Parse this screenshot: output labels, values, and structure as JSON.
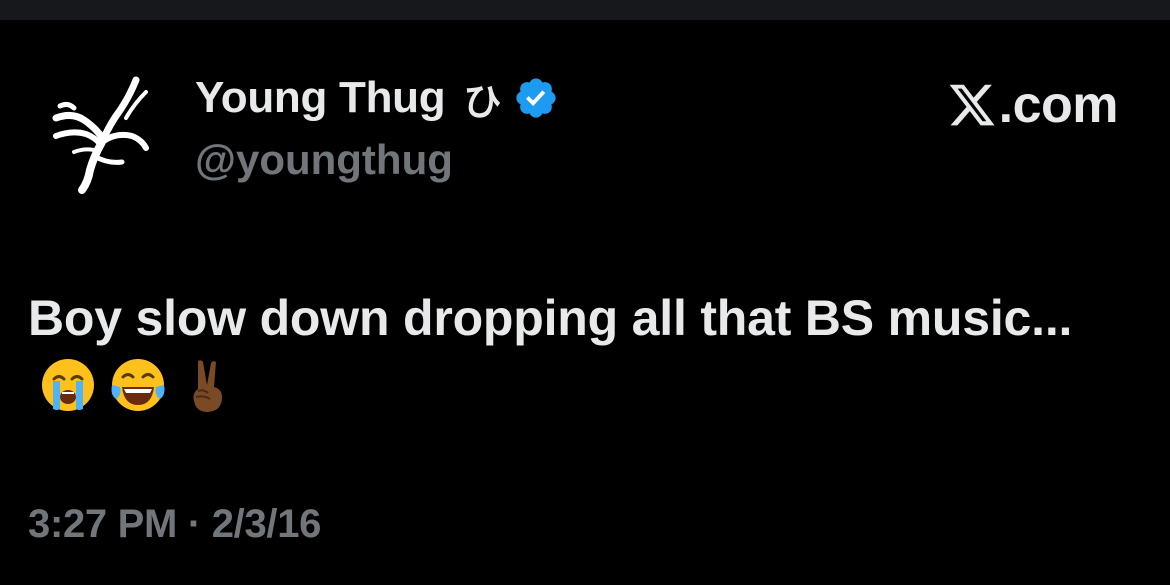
{
  "tweet": {
    "display_name": "Young Thug",
    "name_symbol": "ひ",
    "handle": "@youngthug",
    "text": "Boy slow down dropping all that BS music...",
    "emojis": [
      "loudly-crying-face",
      "face-with-tears-of-joy",
      "victory-hand-medium-dark-skin-tone"
    ],
    "timestamp": "3:27 PM · 2/3/16",
    "verified": true
  },
  "brand": {
    "logo_suffix": ".com"
  },
  "colors": {
    "background": "#000000",
    "primary_text": "#e7e9ea",
    "secondary_text": "#71767b",
    "verified_blue": "#1d9bf0"
  },
  "icons": {
    "avatar": "spider-lily-logo-icon",
    "verified": "verified-badge-icon",
    "brand": "x-logo-icon"
  }
}
